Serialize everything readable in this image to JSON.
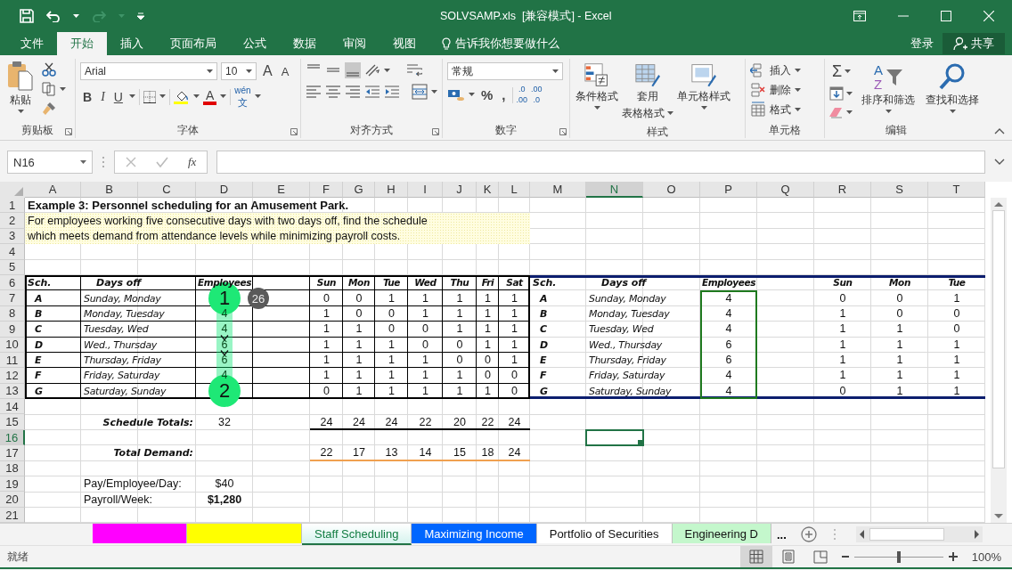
{
  "quick_access": [
    {
      "kind": "save",
      "disabled": false
    },
    {
      "kind": "undo",
      "disabled": false
    },
    {
      "kind": "redo",
      "disabled": true
    },
    {
      "kind": "customize",
      "disabled": false
    }
  ],
  "title": "SOLVSAMP.xls  [兼容模式] - Excel",
  "tabs": [
    {
      "label": "文件",
      "selected": false
    },
    {
      "label": "开始",
      "selected": true
    },
    {
      "label": "插入",
      "selected": false
    },
    {
      "label": "页面布局",
      "selected": false
    },
    {
      "label": "公式",
      "selected": false
    },
    {
      "label": "数据",
      "selected": false
    },
    {
      "label": "审阅",
      "selected": false
    },
    {
      "label": "视图",
      "selected": false
    }
  ],
  "tell_me": "告诉我你想要做什么",
  "sign_in": "登录",
  "share": "共享",
  "ribbon": [
    {
      "kind": "clipboard",
      "label": "剪贴板",
      "paste": "粘贴"
    },
    {
      "kind": "font",
      "label": "字体",
      "font": "Arial",
      "size": "10",
      "grow": "A",
      "shrink": "A",
      "bold": "B",
      "italic": "I",
      "underline": "U",
      "font_color": "A",
      "phonetic": [
        "wén",
        "文"
      ]
    },
    {
      "kind": "alignment",
      "label": "对齐方式"
    },
    {
      "kind": "number",
      "label": "数字",
      "format": "常规",
      "percent": "%",
      "comma": ",",
      "inc_decimal": [
        ".0",
        ".00"
      ],
      "dec_decimal": [
        ".00",
        ".0"
      ]
    },
    {
      "kind": "styles",
      "label": "样式",
      "buttons": [
        [
          "条件格式"
        ],
        [
          "套用",
          "表格格式"
        ],
        [
          "单元格样式"
        ]
      ]
    },
    {
      "kind": "cells",
      "label": "单元格",
      "items": [
        "插入",
        "删除",
        "格式"
      ]
    },
    {
      "kind": "editing",
      "label": "编辑",
      "sum": "Σ",
      "sort_letters": [
        "A",
        "Z"
      ],
      "buttons": [
        "排序和筛选",
        "查找和选择"
      ]
    }
  ],
  "name_box": "N16",
  "function_label": "fx",
  "columns": [
    {
      "letter": "A",
      "selected": false
    },
    {
      "letter": "B",
      "selected": false
    },
    {
      "letter": "C",
      "selected": false
    },
    {
      "letter": "D",
      "selected": false
    },
    {
      "letter": "E",
      "selected": false
    },
    {
      "letter": "F",
      "selected": false
    },
    {
      "letter": "G",
      "selected": false
    },
    {
      "letter": "H",
      "selected": false
    },
    {
      "letter": "I",
      "selected": false
    },
    {
      "letter": "J",
      "selected": false
    },
    {
      "letter": "K",
      "selected": false
    },
    {
      "letter": "L",
      "selected": false
    },
    {
      "letter": "M",
      "selected": false
    },
    {
      "letter": "N",
      "selected": true
    },
    {
      "letter": "O",
      "selected": false
    },
    {
      "letter": "P",
      "selected": false
    },
    {
      "letter": "Q",
      "selected": false
    },
    {
      "letter": "R",
      "selected": false
    },
    {
      "letter": "S",
      "selected": false
    },
    {
      "letter": "T",
      "selected": false
    }
  ],
  "rows": [
    {
      "number": "1",
      "selected": false,
      "cells": {
        "A": {
          "kind": "title",
          "text": "Example 3:  Personnel scheduling for an Amusement Park."
        }
      }
    },
    {
      "number": "2",
      "selected": false,
      "cells": {
        "A": {
          "kind": "note",
          "text": "For employees working five consecutive days with two days off, find the schedule"
        }
      }
    },
    {
      "number": "3",
      "selected": false,
      "cells": {
        "A": {
          "kind": "note",
          "text": "which meets demand from attendance levels while minimizing payroll costs."
        }
      }
    },
    {
      "number": "4",
      "selected": false
    },
    {
      "number": "5",
      "selected": false
    },
    {
      "number": "6",
      "selected": false,
      "cells": {
        "A": {
          "kind": "headl",
          "text": "Sch."
        },
        "B": {
          "kind": "headi",
          "text": "Days off"
        },
        "D": {
          "kind": "head",
          "text": "Employees"
        },
        "F": {
          "kind": "head",
          "text": "Sun"
        },
        "G": {
          "kind": "head",
          "text": "Mon"
        },
        "H": {
          "kind": "head",
          "text": "Tue"
        },
        "I": {
          "kind": "head",
          "text": "Wed"
        },
        "J": {
          "kind": "head",
          "text": "Thu"
        },
        "K": {
          "kind": "head",
          "text": "Fri"
        },
        "L": {
          "kind": "head",
          "text": "Sat"
        },
        "M": {
          "kind": "headl",
          "text": "Sch."
        },
        "N": {
          "kind": "headi",
          "text": "Days off"
        },
        "P": {
          "kind": "head",
          "text": "Employees"
        },
        "R": {
          "kind": "head",
          "text": "Sun"
        },
        "S": {
          "kind": "head",
          "text": "Mon"
        },
        "T": {
          "kind": "head",
          "text": "Tue"
        }
      }
    },
    {
      "number": "7",
      "selected": false,
      "cells": {
        "A": {
          "kind": "key",
          "text": "A"
        },
        "B": {
          "kind": "days",
          "text": "Sunday, Monday"
        },
        "F": {
          "kind": "num",
          "text": "0"
        },
        "G": {
          "kind": "num",
          "text": "0"
        },
        "H": {
          "kind": "num",
          "text": "1"
        },
        "I": {
          "kind": "num",
          "text": "1"
        },
        "J": {
          "kind": "num",
          "text": "1"
        },
        "K": {
          "kind": "num",
          "text": "1"
        },
        "L": {
          "kind": "num",
          "text": "1"
        },
        "M": {
          "kind": "key",
          "text": "A"
        },
        "N": {
          "kind": "days",
          "text": "Sunday, Monday"
        },
        "P": {
          "kind": "num",
          "text": "4"
        },
        "R": {
          "kind": "num",
          "text": "0"
        },
        "S": {
          "kind": "num",
          "text": "0"
        },
        "T": {
          "kind": "num",
          "text": "1"
        }
      }
    },
    {
      "number": "8",
      "selected": false,
      "cells": {
        "A": {
          "kind": "key",
          "text": "B"
        },
        "B": {
          "kind": "days",
          "text": "Monday, Tuesday"
        },
        "D": {
          "kind": "emp",
          "text": "4"
        },
        "F": {
          "kind": "num",
          "text": "1"
        },
        "G": {
          "kind": "num",
          "text": "0"
        },
        "H": {
          "kind": "num",
          "text": "0"
        },
        "I": {
          "kind": "num",
          "text": "1"
        },
        "J": {
          "kind": "num",
          "text": "1"
        },
        "K": {
          "kind": "num",
          "text": "1"
        },
        "L": {
          "kind": "num",
          "text": "1"
        },
        "M": {
          "kind": "key",
          "text": "B"
        },
        "N": {
          "kind": "days",
          "text": "Monday, Tuesday"
        },
        "P": {
          "kind": "num",
          "text": "4"
        },
        "R": {
          "kind": "num",
          "text": "1"
        },
        "S": {
          "kind": "num",
          "text": "0"
        },
        "T": {
          "kind": "num",
          "text": "0"
        }
      }
    },
    {
      "number": "9",
      "selected": false,
      "cells": {
        "A": {
          "kind": "key",
          "text": "C"
        },
        "B": {
          "kind": "days",
          "text": "Tuesday, Wed"
        },
        "D": {
          "kind": "emp",
          "text": "4"
        },
        "F": {
          "kind": "num",
          "text": "1"
        },
        "G": {
          "kind": "num",
          "text": "1"
        },
        "H": {
          "kind": "num",
          "text": "0"
        },
        "I": {
          "kind": "num",
          "text": "0"
        },
        "J": {
          "kind": "num",
          "text": "1"
        },
        "K": {
          "kind": "num",
          "text": "1"
        },
        "L": {
          "kind": "num",
          "text": "1"
        },
        "M": {
          "kind": "key",
          "text": "C"
        },
        "N": {
          "kind": "days",
          "text": "Tuesday, Wed"
        },
        "P": {
          "kind": "num",
          "text": "4"
        },
        "R": {
          "kind": "num",
          "text": "1"
        },
        "S": {
          "kind": "num",
          "text": "1"
        },
        "T": {
          "kind": "num",
          "text": "0"
        }
      }
    },
    {
      "number": "10",
      "selected": false,
      "cells": {
        "A": {
          "kind": "key",
          "text": "D"
        },
        "B": {
          "kind": "days",
          "text": "Wed., Thursday"
        },
        "D": {
          "kind": "emp",
          "text": "6"
        },
        "F": {
          "kind": "num",
          "text": "1"
        },
        "G": {
          "kind": "num",
          "text": "1"
        },
        "H": {
          "kind": "num",
          "text": "1"
        },
        "I": {
          "kind": "num",
          "text": "0"
        },
        "J": {
          "kind": "num",
          "text": "0"
        },
        "K": {
          "kind": "num",
          "text": "1"
        },
        "L": {
          "kind": "num",
          "text": "1"
        },
        "M": {
          "kind": "key",
          "text": "D"
        },
        "N": {
          "kind": "days",
          "text": "Wed., Thursday"
        },
        "P": {
          "kind": "num",
          "text": "6"
        },
        "R": {
          "kind": "num",
          "text": "1"
        },
        "S": {
          "kind": "num",
          "text": "1"
        },
        "T": {
          "kind": "num",
          "text": "1"
        }
      }
    },
    {
      "number": "11",
      "selected": false,
      "cells": {
        "A": {
          "kind": "key",
          "text": "E"
        },
        "B": {
          "kind": "days",
          "text": "Thursday, Friday"
        },
        "D": {
          "kind": "emp",
          "text": "6"
        },
        "F": {
          "kind": "num",
          "text": "1"
        },
        "G": {
          "kind": "num",
          "text": "1"
        },
        "H": {
          "kind": "num",
          "text": "1"
        },
        "I": {
          "kind": "num",
          "text": "1"
        },
        "J": {
          "kind": "num",
          "text": "0"
        },
        "K": {
          "kind": "num",
          "text": "0"
        },
        "L": {
          "kind": "num",
          "text": "1"
        },
        "M": {
          "kind": "key",
          "text": "E"
        },
        "N": {
          "kind": "days",
          "text": "Thursday, Friday"
        },
        "P": {
          "kind": "num",
          "text": "6"
        },
        "R": {
          "kind": "num",
          "text": "1"
        },
        "S": {
          "kind": "num",
          "text": "1"
        },
        "T": {
          "kind": "num",
          "text": "1"
        }
      }
    },
    {
      "number": "12",
      "selected": false,
      "cells": {
        "A": {
          "kind": "key",
          "text": "F"
        },
        "B": {
          "kind": "days",
          "text": "Friday, Saturday"
        },
        "D": {
          "kind": "emp",
          "text": "4"
        },
        "F": {
          "kind": "num",
          "text": "1"
        },
        "G": {
          "kind": "num",
          "text": "1"
        },
        "H": {
          "kind": "num",
          "text": "1"
        },
        "I": {
          "kind": "num",
          "text": "1"
        },
        "J": {
          "kind": "num",
          "text": "1"
        },
        "K": {
          "kind": "num",
          "text": "0"
        },
        "L": {
          "kind": "num",
          "text": "0"
        },
        "M": {
          "kind": "key",
          "text": "F"
        },
        "N": {
          "kind": "days",
          "text": "Friday, Saturday"
        },
        "P": {
          "kind": "num",
          "text": "4"
        },
        "R": {
          "kind": "num",
          "text": "1"
        },
        "S": {
          "kind": "num",
          "text": "1"
        },
        "T": {
          "kind": "num",
          "text": "1"
        }
      }
    },
    {
      "number": "13",
      "selected": false,
      "cells": {
        "A": {
          "kind": "key",
          "text": "G"
        },
        "B": {
          "kind": "days",
          "text": "Saturday, Sunday"
        },
        "F": {
          "kind": "num",
          "text": "0"
        },
        "G": {
          "kind": "num",
          "text": "1"
        },
        "H": {
          "kind": "num",
          "text": "1"
        },
        "I": {
          "kind": "num",
          "text": "1"
        },
        "J": {
          "kind": "num",
          "text": "1"
        },
        "K": {
          "kind": "num",
          "text": "1"
        },
        "L": {
          "kind": "num",
          "text": "0"
        },
        "M": {
          "kind": "key",
          "text": "G"
        },
        "N": {
          "kind": "days",
          "text": "Saturday, Sunday"
        },
        "P": {
          "kind": "num",
          "text": "4"
        },
        "R": {
          "kind": "num",
          "text": "0"
        },
        "S": {
          "kind": "num",
          "text": "1"
        },
        "T": {
          "kind": "num",
          "text": "1"
        }
      }
    },
    {
      "number": "14",
      "selected": false
    },
    {
      "number": "15",
      "selected": false,
      "cells": {
        "C": {
          "kind": "cap",
          "text": "Schedule Totals:"
        },
        "D": {
          "kind": "num",
          "text": "32"
        },
        "F": {
          "kind": "num",
          "text": "24"
        },
        "G": {
          "kind": "num",
          "text": "24"
        },
        "H": {
          "kind": "num",
          "text": "24"
        },
        "I": {
          "kind": "num",
          "text": "22"
        },
        "J": {
          "kind": "num",
          "text": "20"
        },
        "K": {
          "kind": "num",
          "text": "22"
        },
        "L": {
          "kind": "num",
          "text": "24"
        }
      }
    },
    {
      "number": "16",
      "selected": true
    },
    {
      "number": "17",
      "selected": false,
      "cells": {
        "C": {
          "kind": "cap",
          "text": "Total Demand:"
        },
        "F": {
          "kind": "num",
          "text": "22"
        },
        "G": {
          "kind": "num",
          "text": "17"
        },
        "H": {
          "kind": "num",
          "text": "13"
        },
        "I": {
          "kind": "num",
          "text": "14"
        },
        "J": {
          "kind": "num",
          "text": "15"
        },
        "K": {
          "kind": "num",
          "text": "18"
        },
        "L": {
          "kind": "num",
          "text": "24"
        }
      }
    },
    {
      "number": "18",
      "selected": false
    },
    {
      "number": "19",
      "selected": false,
      "cells": {
        "B": {
          "kind": "label",
          "text": "Pay/Employee/Day:"
        },
        "D": {
          "kind": "money",
          "text": "$40"
        }
      }
    },
    {
      "number": "20",
      "selected": false,
      "cells": {
        "B": {
          "kind": "label",
          "text": "Payroll/Week:"
        },
        "D": {
          "kind": "moneyb",
          "text": "$1,280"
        }
      }
    },
    {
      "number": "21",
      "selected": false
    }
  ],
  "annotation": {
    "start": "1",
    "end": "2",
    "count": "26"
  },
  "sheet_tabs": [
    {
      "color": "#ff00ff",
      "selected": false
    },
    {
      "color": "#ffff00",
      "selected": false
    },
    {
      "label": "Staff Scheduling",
      "color": "#d6f3ee",
      "selected": true
    },
    {
      "label": "Maximizing Income",
      "color": "#0066ff",
      "selected": false
    },
    {
      "label": "Portfolio of Securities",
      "color": "#ffffff",
      "selected": false
    },
    {
      "label": "Engineering D",
      "color": "#c4f7cc",
      "selected": false
    }
  ],
  "more_tabs": "...",
  "status": "就绪",
  "views": [
    {
      "kind": "normal",
      "selected": true
    },
    {
      "kind": "page_layout",
      "selected": false
    },
    {
      "kind": "page_break",
      "selected": false
    }
  ],
  "zoom": {
    "level": 0.5,
    "reading": "100%"
  }
}
